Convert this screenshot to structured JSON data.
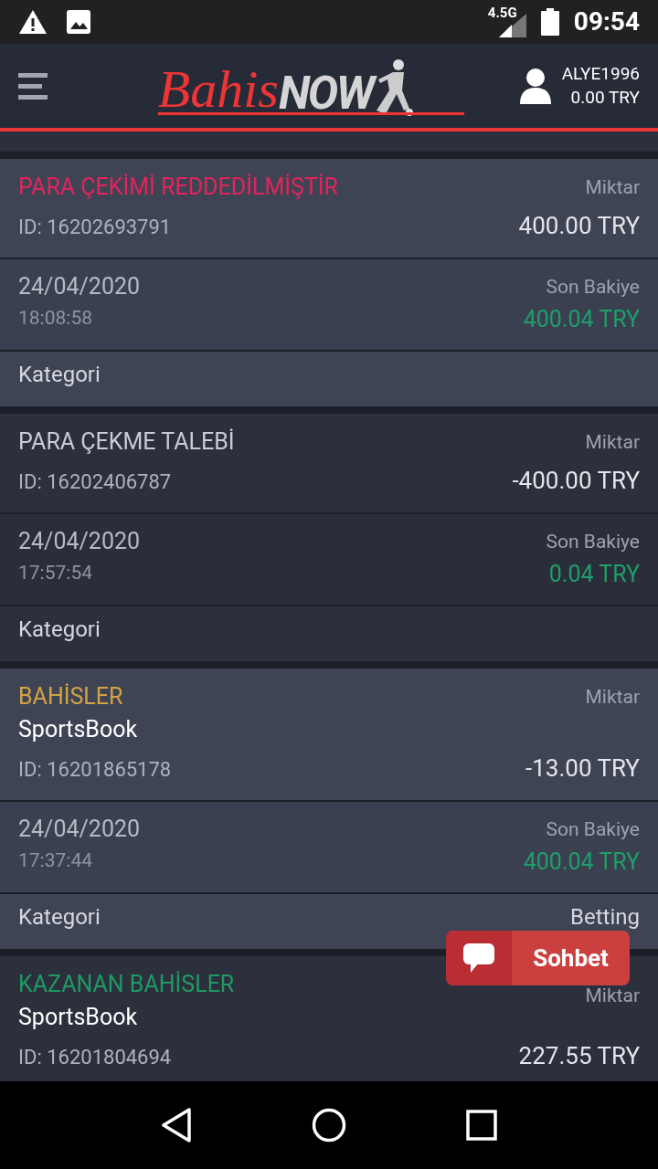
{
  "status_bar": {
    "network": "4.5G",
    "time": "09:54"
  },
  "header": {
    "logo": {
      "part_1": "Bahis",
      "part_2": "NOW"
    },
    "user": {
      "name": "ALYE1996",
      "balance": "0.00 TRY"
    }
  },
  "transactions": [
    {
      "title": "PARA ÇEKİMİ REDDEDİLMİŞTİR",
      "color": "#e3245a",
      "amount_label": "Miktar",
      "id": "ID: 16202693791",
      "amount": "400.00 TRY",
      "date": "24/04/2020",
      "time": "18:08:58",
      "balance_label": "Son Bakiye",
      "balance": "400.04 TRY",
      "category_label": "Kategori"
    },
    {
      "title": "PARA ÇEKME TALEBİ",
      "color": "#c9ccd6",
      "amount_label": "Miktar",
      "id": "ID: 16202406787",
      "amount": "-400.00 TRY",
      "date": "24/04/2020",
      "time": "17:57:54",
      "balance_label": "Son Bakiye",
      "balance": "0.04 TRY",
      "category_label": "Kategori"
    },
    {
      "title": "BAHİSLER",
      "color": "#d3a443",
      "subtitle": "SportsBook",
      "amount_label": "Miktar",
      "id": "ID: 16201865178",
      "amount": "-13.00 TRY",
      "date": "24/04/2020",
      "time": "17:37:44",
      "balance_label": "Son Bakiye",
      "balance": "400.04 TRY",
      "category_label": "Kategori",
      "category": "Betting"
    },
    {
      "title": "KAZANAN BAHİSLER",
      "color": "#1e9a62",
      "subtitle": "SportsBook",
      "amount_label": "Miktar",
      "id": "ID: 16201804694",
      "amount": "227.55 TRY"
    }
  ],
  "chat_button": {
    "label": "Sohbet"
  }
}
